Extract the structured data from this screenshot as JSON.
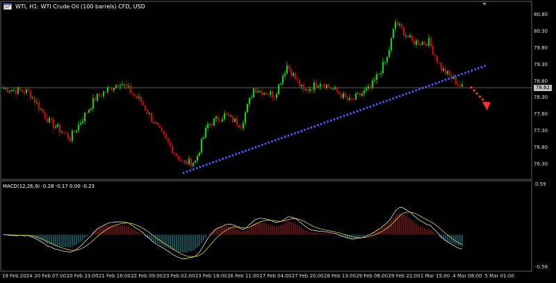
{
  "window": {
    "title": "WTI, H1:  WTI Crude Oil (100 barrels) CFD, USD",
    "current_price": "78.62"
  },
  "macd_panel": {
    "title": "MACD(12,26,9) -0.28 -0.17 0.00 -0.23",
    "top_label": "0.59",
    "bottom_label": "-0.58"
  },
  "price_axis": [
    "80.80",
    "80.30",
    "79.80",
    "79.30",
    "78.80",
    "78.30",
    "77.80",
    "77.30",
    "76.80",
    "76.30"
  ],
  "time_axis": [
    "19 Feb 2024",
    "20 Feb 07:00",
    "20 Feb 23:00",
    "21 Feb 16:00",
    "22 Feb 09:00",
    "23 Feb 02:00",
    "23 Feb 18:00",
    "26 Feb 11:00",
    "27 Feb 04:00",
    "27 Feb 20:00",
    "28 Feb 13:00",
    "29 Feb 06:00",
    "29 Feb 22:00",
    "1 Mar 15:00",
    "4 Mar 08:00",
    "5 Mar 01:00"
  ],
  "colors": {
    "bull": "#00e000",
    "bear": "#e00000",
    "trendline": "#4a5cff",
    "forecast": "#ff3030",
    "macd_pos": "#c02020",
    "macd_neg": "#20a0b0",
    "macd_line": "#e0e0e0",
    "signal_line": "#e0d040"
  },
  "chart_data": {
    "type": "candlestick",
    "price_range": [
      75.9,
      81.1
    ],
    "macd_range": [
      -0.58,
      0.59
    ],
    "key_closes": [
      {
        "index": 0,
        "price": 78.6
      },
      {
        "index": 12,
        "price": 78.5
      },
      {
        "index": 22,
        "price": 77.6
      },
      {
        "index": 32,
        "price": 77.1
      },
      {
        "index": 44,
        "price": 78.3
      },
      {
        "index": 56,
        "price": 78.8
      },
      {
        "index": 66,
        "price": 78.2
      },
      {
        "index": 76,
        "price": 77.2
      },
      {
        "index": 86,
        "price": 76.35
      },
      {
        "index": 92,
        "price": 76.4
      },
      {
        "index": 98,
        "price": 77.5
      },
      {
        "index": 106,
        "price": 77.8
      },
      {
        "index": 114,
        "price": 77.5
      },
      {
        "index": 120,
        "price": 78.6
      },
      {
        "index": 130,
        "price": 78.4
      },
      {
        "index": 136,
        "price": 79.3
      },
      {
        "index": 144,
        "price": 78.5
      },
      {
        "index": 152,
        "price": 78.8
      },
      {
        "index": 160,
        "price": 78.5
      },
      {
        "index": 166,
        "price": 78.2
      },
      {
        "index": 176,
        "price": 78.6
      },
      {
        "index": 184,
        "price": 79.5
      },
      {
        "index": 188,
        "price": 80.6
      },
      {
        "index": 196,
        "price": 80.0
      },
      {
        "index": 204,
        "price": 80.0
      },
      {
        "index": 210,
        "price": 79.2
      },
      {
        "index": 220,
        "price": 78.62
      }
    ],
    "trendline": {
      "start": {
        "index": 86,
        "price": 76.05
      },
      "end": {
        "index": 232,
        "price": 79.3
      }
    },
    "forecast": {
      "start": {
        "index": 224,
        "price": 78.65
      },
      "end": {
        "index": 232,
        "price": 78.0
      }
    }
  }
}
